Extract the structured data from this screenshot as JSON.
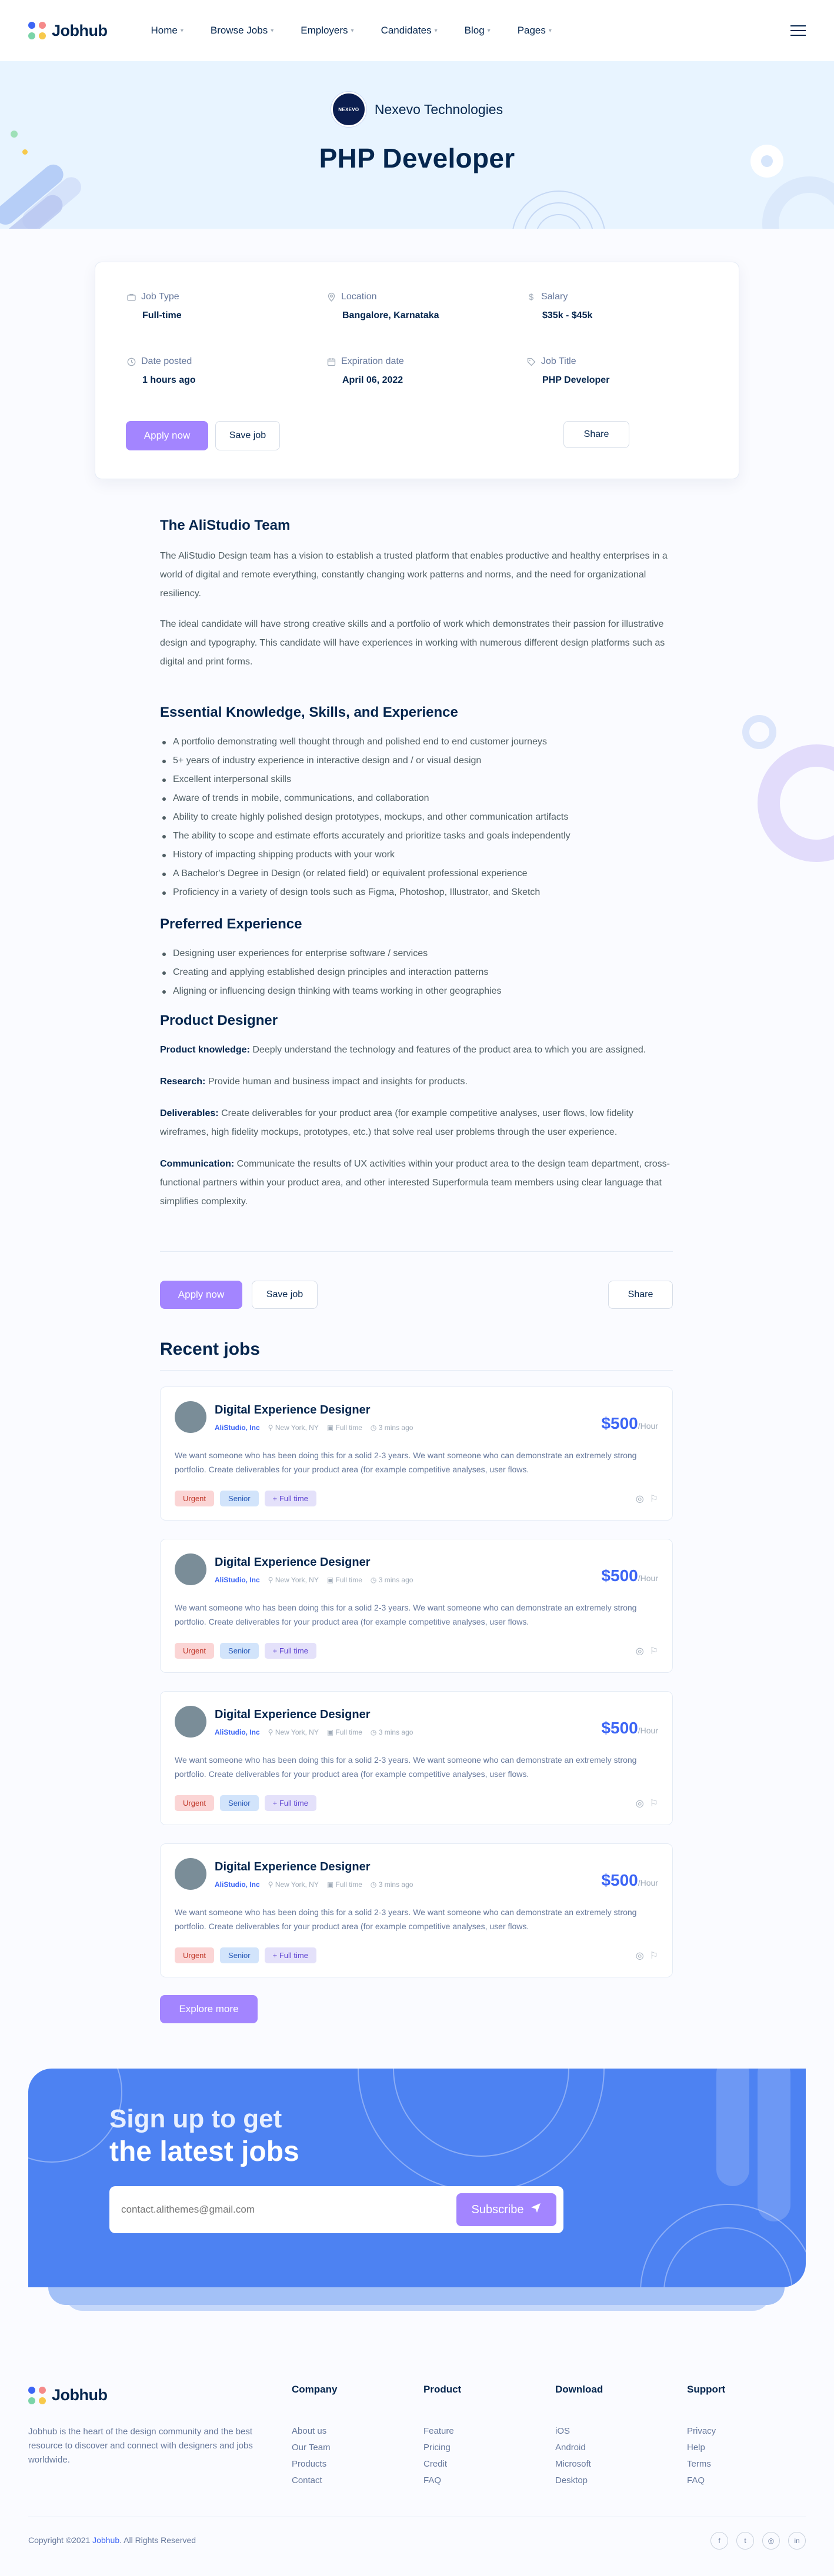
{
  "brand": {
    "name": "Jobhub"
  },
  "nav": [
    {
      "label": "Home"
    },
    {
      "label": "Browse Jobs"
    },
    {
      "label": "Employers"
    },
    {
      "label": "Candidates"
    },
    {
      "label": "Blog"
    },
    {
      "label": "Pages"
    }
  ],
  "hero": {
    "company_name": "Nexevo Technologies",
    "company_logo_text": "NEXEVO",
    "job_title": "PHP Developer"
  },
  "meta": {
    "job_type_label": "Job Type",
    "job_type_value": "Full-time",
    "location_label": "Location",
    "location_value": "Bangalore, Karnataka",
    "salary_label": "Salary",
    "salary_value": "$35k - $45k",
    "date_label": "Date posted",
    "date_value": "1 hours ago",
    "expiration_label": "Expiration date",
    "expiration_value": "April 06, 2022",
    "title_label": "Job Title",
    "title_value": "PHP Developer",
    "apply_label": "Apply now",
    "save_label": "Save job",
    "share_label": "Share"
  },
  "about": {
    "heading": "The AliStudio Team",
    "p1": "The AliStudio Design team has a vision to establish a trusted platform that enables productive and healthy enterprises in a world of digital and remote everything, constantly changing work patterns and norms, and the need for organizational resiliency.",
    "p2": "The ideal candidate will have strong creative skills and a portfolio of work which demonstrates their passion for illustrative design and typography. This candidate will have experiences in working with numerous different design platforms such as digital and print forms."
  },
  "essential": {
    "heading": "Essential Knowledge, Skills, and Experience",
    "items": [
      "A portfolio demonstrating well thought through and polished end to end customer journeys",
      "5+ years of industry experience in interactive design and / or visual design",
      "Excellent interpersonal skills",
      "Aware of trends in mobile, communications, and collaboration",
      "Ability to create highly polished design prototypes, mockups, and other communication artifacts",
      "The ability to scope and estimate efforts accurately and prioritize tasks and goals independently",
      "History of impacting shipping products with your work",
      "A Bachelor's Degree in Design (or related field) or equivalent professional experience",
      "Proficiency in a variety of design tools such as Figma, Photoshop, Illustrator, and Sketch"
    ]
  },
  "preferred": {
    "heading": "Preferred Experience",
    "items": [
      "Designing user experiences for enterprise software / services",
      "Creating and applying established design principles and interaction patterns",
      "Aligning or influencing design thinking with teams working in other geographies"
    ]
  },
  "designer": {
    "heading": "Product Designer",
    "items": [
      {
        "term": "Product knowledge:",
        "text": "Deeply understand the technology and features of the product area to which you are assigned."
      },
      {
        "term": "Research:",
        "text": "Provide human and business impact and insights for products."
      },
      {
        "term": "Deliverables:",
        "text": "Create deliverables for your product area (for example competitive analyses, user flows, low fidelity wireframes, high fidelity mockups, prototypes, etc.) that solve real user problems through the user experience."
      },
      {
        "term": "Communication:",
        "text": "Communicate the results of UX activities within your product area to the design team department, cross-functional partners within your product area, and other interested Superformula team members using clear language that simplifies complexity."
      }
    ]
  },
  "actions2": {
    "apply_label": "Apply now",
    "save_label": "Save job",
    "share_label": "Share"
  },
  "recent": {
    "heading": "Recent jobs",
    "jobs": [
      {
        "title": "Digital Experience Designer",
        "company": "AliStudio, Inc",
        "location": "New York, NY",
        "type": "Full time",
        "posted": "3 mins ago",
        "price": "$500",
        "unit": "/Hour",
        "desc": "We want someone who has been doing this for a solid 2-3 years. We want someone who can demonstrate an extremely strong portfolio. Create deliverables for your product area (for example competitive analyses, user flows.",
        "tags": [
          "Urgent",
          "Senior",
          "+ Full time"
        ]
      },
      {
        "title": "Digital Experience Designer",
        "company": "AliStudio, Inc",
        "location": "New York, NY",
        "type": "Full time",
        "posted": "3 mins ago",
        "price": "$500",
        "unit": "/Hour",
        "desc": "We want someone who has been doing this for a solid 2-3 years. We want someone who can demonstrate an extremely strong portfolio. Create deliverables for your product area (for example competitive analyses, user flows.",
        "tags": [
          "Urgent",
          "Senior",
          "+ Full time"
        ]
      },
      {
        "title": "Digital Experience Designer",
        "company": "AliStudio, Inc",
        "location": "New York, NY",
        "type": "Full time",
        "posted": "3 mins ago",
        "price": "$500",
        "unit": "/Hour",
        "desc": "We want someone who has been doing this for a solid 2-3 years. We want someone who can demonstrate an extremely strong portfolio. Create deliverables for your product area (for example competitive analyses, user flows.",
        "tags": [
          "Urgent",
          "Senior",
          "+ Full time"
        ]
      },
      {
        "title": "Digital Experience Designer",
        "company": "AliStudio, Inc",
        "location": "New York, NY",
        "type": "Full time",
        "posted": "3 mins ago",
        "price": "$500",
        "unit": "/Hour",
        "desc": "We want someone who has been doing this for a solid 2-3 years. We want someone who can demonstrate an extremely strong portfolio. Create deliverables for your product area (for example competitive analyses, user flows.",
        "tags": [
          "Urgent",
          "Senior",
          "+ Full time"
        ]
      }
    ],
    "explore_label": "Explore more"
  },
  "newsletter": {
    "title_line1": "Sign up to get",
    "title_line2": "the latest jobs",
    "placeholder": "contact.alithemes@gmail.com",
    "button_label": "Subscribe"
  },
  "footer": {
    "brand": "Jobhub",
    "about": "Jobhub is the heart of the design community and the best resource to discover and connect with designers and jobs worldwide.",
    "columns": [
      {
        "title": "Company",
        "links": [
          "About us",
          "Our Team",
          "Products",
          "Contact"
        ]
      },
      {
        "title": "Product",
        "links": [
          "Feature",
          "Pricing",
          "Credit",
          "FAQ"
        ]
      },
      {
        "title": "Download",
        "links": [
          "iOS",
          "Android",
          "Microsoft",
          "Desktop"
        ]
      },
      {
        "title": "Support",
        "links": [
          "Privacy",
          "Help",
          "Terms",
          "FAQ"
        ]
      }
    ],
    "copyright_prefix": "Copyright ©2021",
    "copyright_brand": "Jobhub",
    "copyright_suffix": ". All Rights Reserved",
    "social_icons": [
      "facebook-icon",
      "twitter-icon",
      "instagram-icon",
      "linkedin-icon"
    ]
  },
  "colors": {
    "primary_purple": "#a385ff",
    "brand_blue": "#3c65f5",
    "heading_navy": "#05264e",
    "newsletter_blue": "#4d82f2",
    "hero_bg": "#e8f4ff"
  }
}
